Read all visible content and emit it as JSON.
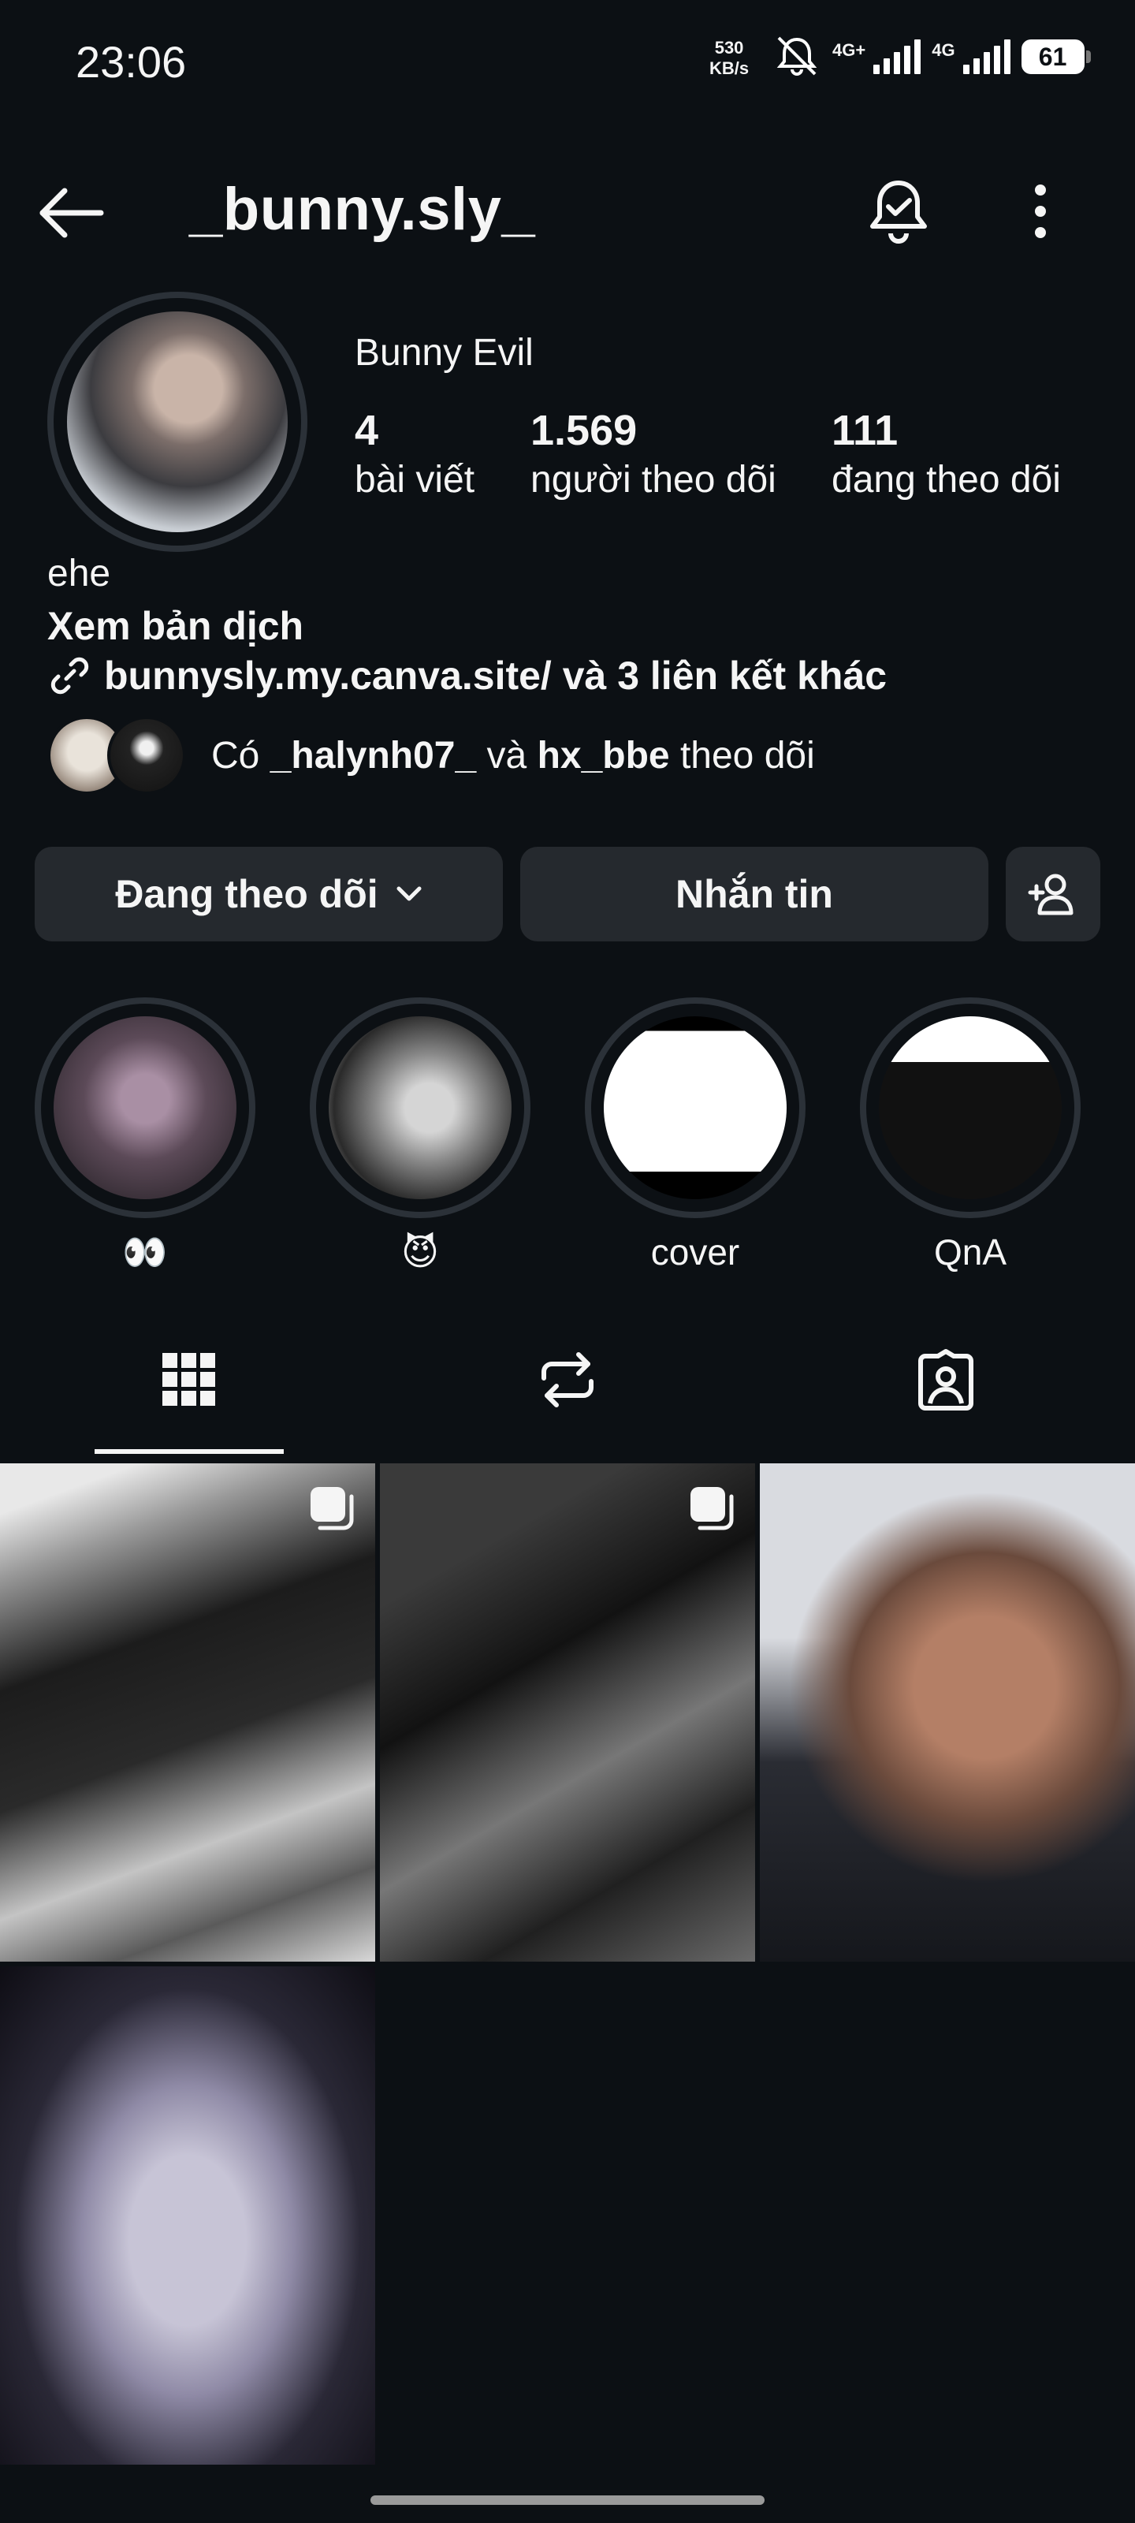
{
  "status_bar": {
    "time": "23:06",
    "net_speed_value": "530",
    "net_speed_unit": "KB/s",
    "network_1": "4G+",
    "network_2": "4G",
    "battery": "61"
  },
  "header": {
    "username": "_bunny.sly_",
    "icons": [
      "back-arrow-icon",
      "bell-icon",
      "more-vertical-icon"
    ]
  },
  "profile": {
    "full_name": "Bunny Evil",
    "stats": [
      {
        "value": "4",
        "label": "bài viết"
      },
      {
        "value": "1.569",
        "label": "người theo dõi"
      },
      {
        "value": "111",
        "label": "đang theo dõi"
      }
    ],
    "bio": "ehe",
    "translate": "Xem bản dịch",
    "link": "bunnysly.my.canva.site/ và 3 liên kết khác",
    "followed_by": {
      "prefix": "Có",
      "user1": "_halynh07_",
      "conj": "và",
      "user2": "hx_bbe",
      "suffix": "theo dõi"
    }
  },
  "actions": {
    "following_label": "Đang theo dõi",
    "message_label": "Nhắn tin"
  },
  "highlights": [
    {
      "label": "👀"
    },
    {
      "label": "😈"
    },
    {
      "label": "cover"
    },
    {
      "label": "QnA"
    }
  ],
  "tabs": [
    "grid-icon",
    "reels-repost-icon",
    "tagged-icon"
  ],
  "colors": {
    "background": "#0c1014",
    "button": "#25292e",
    "ring": "#2b3138",
    "text": "#f5f5f5"
  }
}
